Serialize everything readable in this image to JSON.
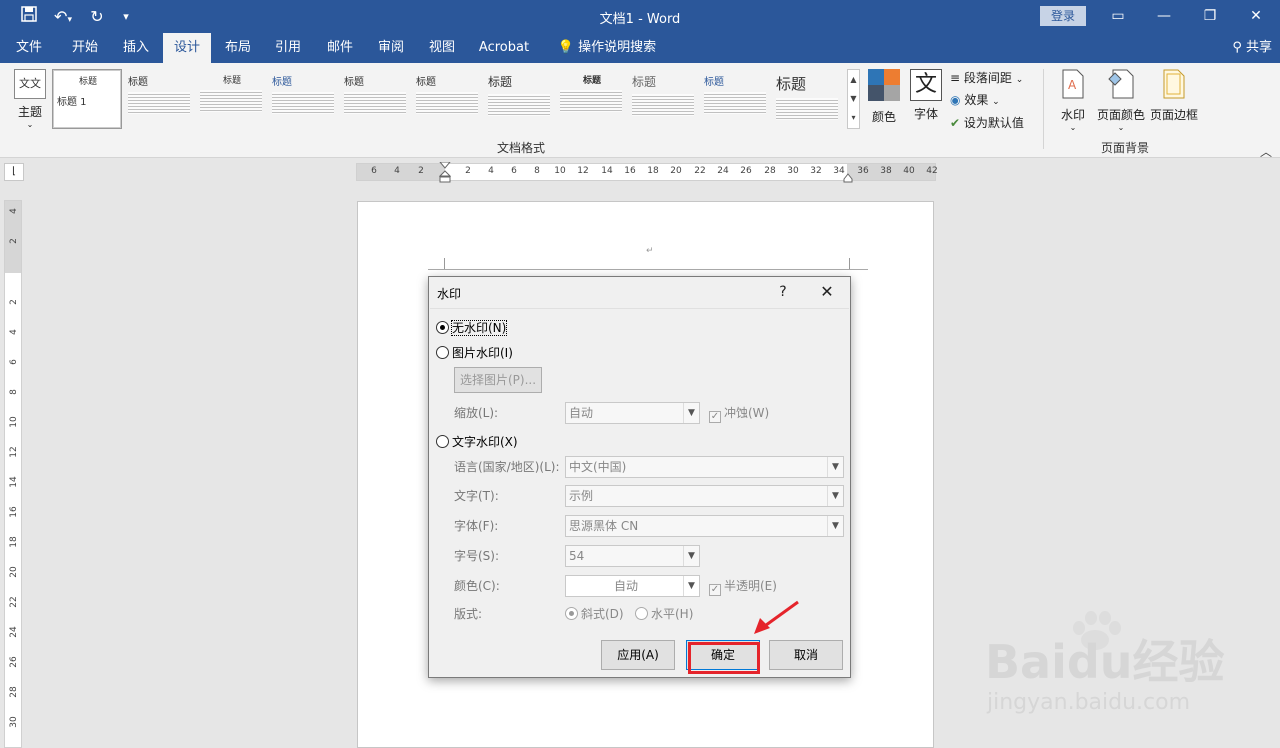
{
  "titlebar": {
    "title": "文档1 - Word",
    "login": "登录",
    "icons": [
      "save-icon",
      "undo-icon",
      "redo-icon",
      "customize-qat-icon",
      "ribbon-display-icon",
      "minimize-icon",
      "restore-icon",
      "close-icon"
    ]
  },
  "tabs": [
    "文件",
    "开始",
    "插入",
    "设计",
    "布局",
    "引用",
    "邮件",
    "审阅",
    "视图",
    "Acrobat",
    "操作说明搜索"
  ],
  "active_tab": "设计",
  "share": "共享",
  "ribbon": {
    "theme": "主题",
    "gallery": [
      {
        "title": "标题"
      },
      {
        "title": "标题"
      },
      {
        "title": "标题"
      },
      {
        "title": "标题"
      },
      {
        "title": "标题"
      },
      {
        "title": "标题"
      },
      {
        "title": "标题"
      },
      {
        "title": "标题"
      },
      {
        "title": "标题"
      },
      {
        "title": "标题"
      },
      {
        "title": "标题"
      }
    ],
    "gallery_first_sub": "标题 1",
    "doc_format_label": "文档格式",
    "colors": "颜色",
    "fonts": "字体",
    "fonts_glyph": "文",
    "para_spacing": "段落间距",
    "effects": "效果",
    "set_default": "设为默认值",
    "watermark": "水印",
    "page_color": "页面颜色",
    "page_border": "页面边框",
    "page_bg_label": "页面背景"
  },
  "ruler": {
    "h_ticks": [
      "6",
      "4",
      "2",
      "2",
      "4",
      "6",
      "8",
      "10",
      "12",
      "14",
      "16",
      "18",
      "20",
      "22",
      "24",
      "26",
      "28",
      "30",
      "32",
      "34",
      "36",
      "38",
      "40",
      "42"
    ],
    "v_ticks": [
      "4",
      "2",
      "2",
      "4",
      "6",
      "8",
      "10",
      "12",
      "14",
      "16",
      "18",
      "20",
      "22",
      "24",
      "26",
      "28",
      "30"
    ]
  },
  "dialog": {
    "title": "水印",
    "help": "?",
    "no_watermark": "无水印(N)",
    "picture_watermark": "图片水印(I)",
    "select_picture": "选择图片(P)...",
    "scale_label": "缩放(L):",
    "scale_value": "自动",
    "washout": "冲蚀(W)",
    "text_watermark": "文字水印(X)",
    "language_label": "语言(国家/地区)(L):",
    "language_value": "中文(中国)",
    "text_label": "文字(T):",
    "text_value": "示例",
    "font_label": "字体(F):",
    "font_value": "思源黑体 CN",
    "size_label": "字号(S):",
    "size_value": "54",
    "color_label": "颜色(C):",
    "color_value": "自动",
    "semitransparent": "半透明(E)",
    "layout_label": "版式:",
    "diagonal": "斜式(D)",
    "horizontal": "水平(H)",
    "apply": "应用(A)",
    "ok": "确定",
    "cancel": "取消"
  },
  "watermark_logo": {
    "text": "Baidu经验",
    "url": "jingyan.baidu.com"
  },
  "colors": {
    "brand": "#2b579a",
    "highlight": "#e5242b"
  }
}
